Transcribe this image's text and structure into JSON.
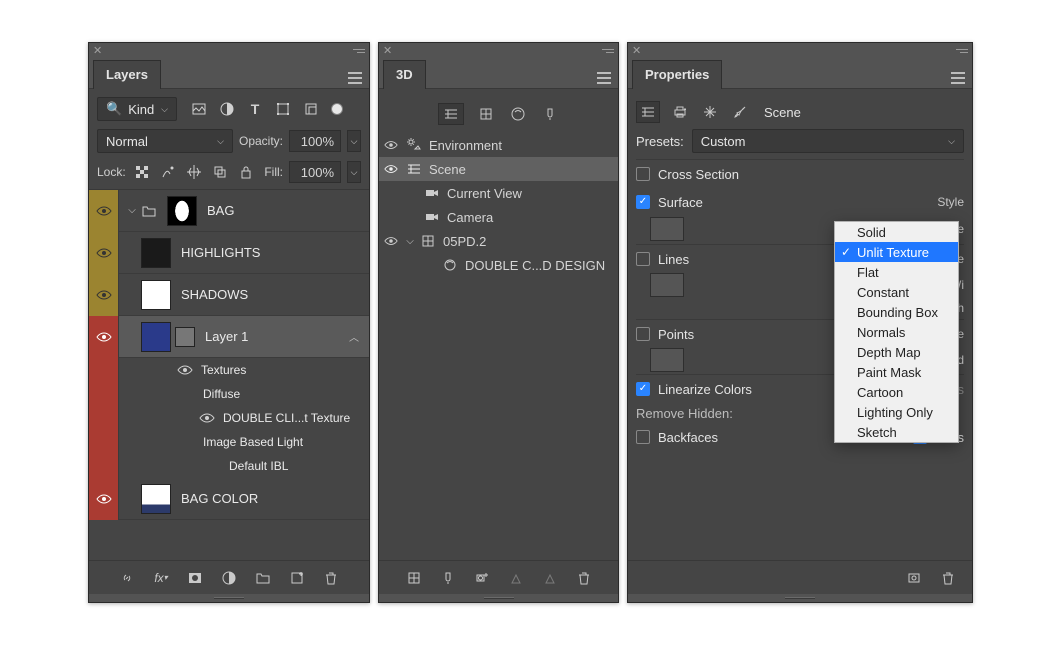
{
  "layers_panel": {
    "title": "Layers",
    "filter_label": "Kind",
    "blend_mode": "Normal",
    "opacity_label": "Opacity:",
    "opacity_value": "100%",
    "lock_label": "Lock:",
    "fill_label": "Fill:",
    "fill_value": "100%",
    "layers": [
      {
        "eye": "y",
        "open": true,
        "folder": true,
        "thumb": "white",
        "name": "BAG"
      },
      {
        "eye": "y",
        "thumb": "dark",
        "name": "HIGHLIGHTS"
      },
      {
        "eye": "y",
        "thumb": "white",
        "name": "SHADOWS"
      },
      {
        "eye": "r",
        "thumb": "blue",
        "thumb2": "sm",
        "name": "Layer 1",
        "selected": true
      },
      {
        "sub": true,
        "eye": "r",
        "name": "Textures",
        "eye_visible": true
      },
      {
        "sub": true,
        "eye": "none",
        "name": "Diffuse"
      },
      {
        "sub": true,
        "eye": "r",
        "name": "DOUBLE CLI...t Texture",
        "eye_visible": true,
        "indent": 1
      },
      {
        "sub": true,
        "eye": "none",
        "name": "Image Based Light"
      },
      {
        "sub": true,
        "eye": "none",
        "name": "Default IBL",
        "indent": 1
      },
      {
        "eye": "r",
        "thumb": "bc",
        "name": "BAG COLOR"
      }
    ]
  },
  "three_d_panel": {
    "title": "3D",
    "tree": [
      {
        "eye": true,
        "icon": "env",
        "label": "Environment"
      },
      {
        "eye": true,
        "icon": "scene",
        "label": "Scene",
        "selected": true,
        "twist": false
      },
      {
        "eye": false,
        "icon": "camera",
        "label": "Current View",
        "indent": 1
      },
      {
        "eye": false,
        "icon": "camera",
        "label": "Camera",
        "indent": 1
      },
      {
        "eye": true,
        "icon": "mesh",
        "label": "05PD.2",
        "twist": true
      },
      {
        "eye": false,
        "icon": "mat",
        "label": "DOUBLE C...D DESIGN",
        "indent": 2
      }
    ]
  },
  "properties_panel": {
    "title": "Properties",
    "header_label": "Scene",
    "presets_label": "Presets:",
    "presets_value": "Custom",
    "cross_section": {
      "label": "Cross Section",
      "checked": false
    },
    "surface": {
      "label": "Surface",
      "checked": true,
      "style_label": "Style",
      "texture_label": "Texture"
    },
    "lines": {
      "label": "Lines",
      "checked": false,
      "style_label": "Style",
      "width_label": "Wi",
      "angle_label": "Angle Thresh"
    },
    "points": {
      "label": "Points",
      "checked": false,
      "style_label": "Style",
      "radius_label": "Rad"
    },
    "linearize": {
      "label": "Linearize Colors",
      "checked": true
    },
    "shadows": {
      "label": "Shadows",
      "checked": true
    },
    "remove_hidden_label": "Remove Hidden:",
    "backfaces": {
      "label": "Backfaces",
      "checked": false
    },
    "lines_flag": {
      "label": "Lines",
      "checked": true
    },
    "style_dropdown": {
      "selected": "Unlit Texture",
      "options": [
        "Solid",
        "Unlit Texture",
        "Flat",
        "Constant",
        "Bounding Box",
        "Normals",
        "Depth Map",
        "Paint Mask",
        "Cartoon",
        "Lighting Only",
        "Sketch"
      ]
    }
  }
}
